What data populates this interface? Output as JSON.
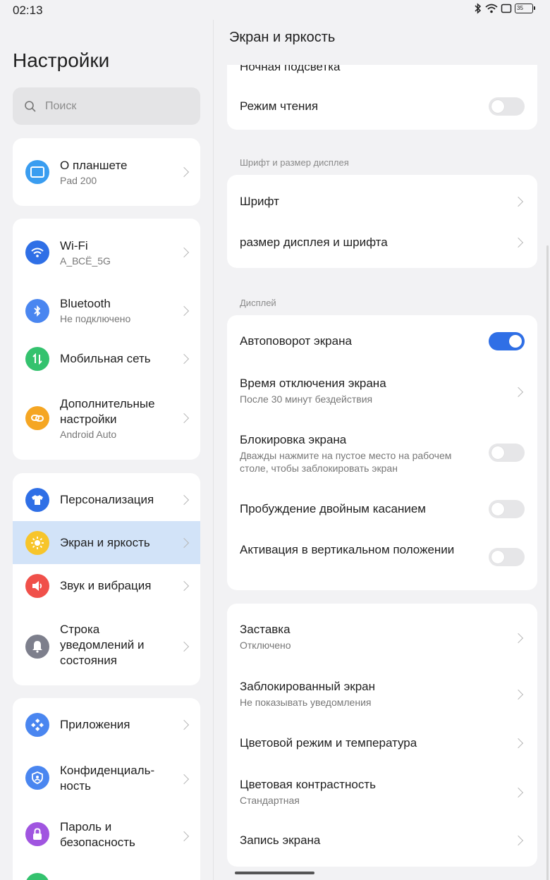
{
  "status": {
    "time": "02:13",
    "battery": "35"
  },
  "left": {
    "title": "Настройки",
    "search_placeholder": "Поиск",
    "items": [
      {
        "title": "О планшете",
        "sub": "Pad 200",
        "icon": "tablet-icon",
        "color": "#3a9df0"
      },
      {
        "title": "Wi-Fi",
        "sub": "A_ВСЁ_5G",
        "icon": "wifi-icon",
        "color": "#2f6fe6"
      },
      {
        "title": "Bluetooth",
        "sub": "Не подключено",
        "icon": "bluetooth-icon",
        "color": "#4a86f0"
      },
      {
        "title": "Мобильная сеть",
        "sub": "",
        "icon": "mobile-network-icon",
        "color": "#34c26e"
      },
      {
        "title": "Дополнительные настройки",
        "sub": "Android Auto",
        "icon": "link-icon",
        "color": "#f5a623"
      },
      {
        "title": "Персонализация",
        "sub": "",
        "icon": "shirt-icon",
        "color": "#2f6fe6"
      },
      {
        "title": "Экран и яркость",
        "sub": "",
        "icon": "sun-icon",
        "color": "#f7c52b"
      },
      {
        "title": "Звук и вибрация",
        "sub": "",
        "icon": "speaker-icon",
        "color": "#f0504a"
      },
      {
        "title": "Строка уведомлений и состояния",
        "sub": "",
        "icon": "bell-icon",
        "color": "#7d7f8c"
      },
      {
        "title": "Приложения",
        "sub": "",
        "icon": "apps-icon",
        "color": "#4a86f0"
      },
      {
        "title": "Конфиденциаль-ность",
        "sub": "",
        "icon": "shield-icon",
        "color": "#4a86f0"
      },
      {
        "title": "Пароль и безопасность",
        "sub": "",
        "icon": "lock-icon",
        "color": "#a055e0"
      }
    ]
  },
  "right": {
    "title": "Экран и яркость",
    "partial_item": "Ночная подсветка",
    "reading_mode": "Режим чтения",
    "section_font": "Шрифт и размер дисплея",
    "font": "Шрифт",
    "display_size": "размер дисплея и шрифта",
    "section_display": "Дисплей",
    "autorotate": "Автоповорот экрана",
    "timeout_title": "Время отключения экрана",
    "timeout_sub": "После 30 минут бездействия",
    "lock_title": "Блокировка экрана",
    "lock_sub": "Дважды нажмите на пустое место на рабочем столе, чтобы заблокировать экран",
    "doubletap": "Пробуждение двойным касанием",
    "raise_wake": "Активация в вертикальном положении",
    "screensaver_title": "Заставка",
    "screensaver_sub": "Отключено",
    "lockscreen_title": "Заблокированный экран",
    "lockscreen_sub": "Не показывать уведомления",
    "color_mode": "Цветовой режим и температура",
    "contrast_title": "Цветовая контрастность",
    "contrast_sub": "Стандартная",
    "screen_record": "Запись экрана"
  }
}
